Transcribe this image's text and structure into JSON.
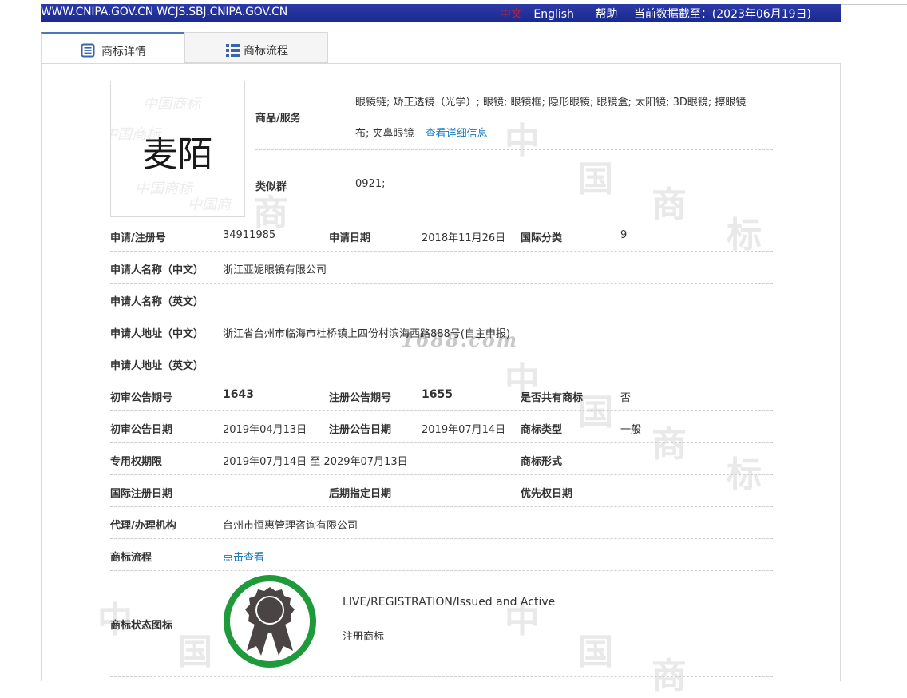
{
  "topbar": {
    "sites": "WWW.CNIPA.GOV.CN WCJS.SBJ.CNIPA.GOV.CN",
    "lang_zh": "中文",
    "lang_en": "English",
    "help": "帮助",
    "data_cutoff": "当前数据截至：(2023年06月19日)"
  },
  "tabs": [
    {
      "label": "商标详情",
      "icon": "document-icon"
    },
    {
      "label": "商标流程",
      "icon": "list-icon"
    }
  ],
  "mark": {
    "text": "麦陌",
    "watermark_text": "中国商标"
  },
  "goods": {
    "label": "商品/服务",
    "line1": "眼镜链; 矫正透镜（光学）; 眼镜; 眼镜框; 隐形眼镜; 眼镜盒; 太阳镜; 3D眼镜; 擦眼镜",
    "line2": "布; 夹鼻眼镜",
    "detail_link": "查看详细信息"
  },
  "similar_group": {
    "label": "类似群",
    "value": "0921;"
  },
  "fields": {
    "reg_no": {
      "label": "申请/注册号",
      "value": "34911985"
    },
    "apply_date": {
      "label": "申请日期",
      "value": "2018年11月26日"
    },
    "intl_class": {
      "label": "国际分类",
      "value": "9"
    },
    "applicant_cn": {
      "label": "申请人名称（中文）",
      "value": "浙江亚妮眼镜有限公司"
    },
    "applicant_en": {
      "label": "申请人名称（英文）",
      "value": ""
    },
    "address_cn": {
      "label": "申请人地址（中文）",
      "value": "浙江省台州市临海市杜桥镇上四份村滨海西路888号(自主申报)"
    },
    "address_en": {
      "label": "申请人地址（英文）",
      "value": ""
    },
    "prelim_issue": {
      "label": "初审公告期号",
      "value": "1643"
    },
    "reg_issue": {
      "label": "注册公告期号",
      "value": "1655"
    },
    "shared": {
      "label": "是否共有商标",
      "value": "否"
    },
    "prelim_date": {
      "label": "初审公告日期",
      "value": "2019年04月13日"
    },
    "reg_date": {
      "label": "注册公告日期",
      "value": "2019年07月14日"
    },
    "mark_type": {
      "label": "商标类型",
      "value": "一般"
    },
    "exclusive_period": {
      "label": "专用权期限",
      "value": "2019年07月14日 至 2029年07月13日"
    },
    "mark_form": {
      "label": "商标形式",
      "value": ""
    },
    "intl_reg_date": {
      "label": "国际注册日期",
      "value": ""
    },
    "later_desig_date": {
      "label": "后期指定日期",
      "value": ""
    },
    "priority_date": {
      "label": "优先权日期",
      "value": ""
    },
    "agent": {
      "label": "代理/办理机构",
      "value": "台州市恒惠管理咨询有限公司"
    },
    "process": {
      "label": "商标流程",
      "value": "点击查看"
    },
    "status_icon": {
      "label": "商标状态图标"
    }
  },
  "status": {
    "en": "LIVE/REGISTRATION/Issued and Active",
    "cn": "注册商标",
    "badge_ring_color": "#1f9a3a",
    "badge_color": "#4a4444"
  },
  "watermark": {
    "site": "1688.com",
    "chars": [
      "中",
      "国",
      "商",
      "标"
    ]
  },
  "colors": {
    "topbar": "#1b2a8f",
    "link": "#1a7bbd",
    "tab_accent": "#4a77bb"
  }
}
